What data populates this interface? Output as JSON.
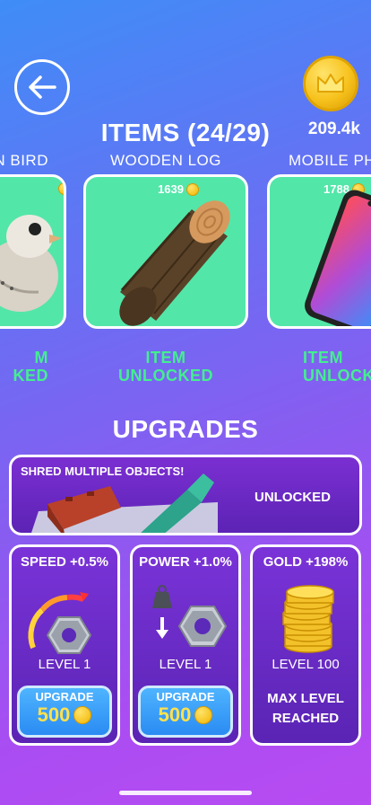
{
  "header": {
    "back_icon": "arrow-left-icon",
    "coin_icon": "crown-coin-icon",
    "coin_balance": "209.4k",
    "title": "ITEMS (24/29)"
  },
  "items": [
    {
      "name": "N BIRD",
      "price": "",
      "status_line1": "M",
      "status_line2": "KED",
      "image": "toy-bird"
    },
    {
      "name": "WOODEN LOG",
      "price": "1639",
      "status_line1": "ITEM",
      "status_line2": "UNLOCKED",
      "image": "wooden-log"
    },
    {
      "name": "MOBILE PH",
      "price": "1788",
      "status_line1": "ITEM",
      "status_line2": "UNLOCKED",
      "image": "mobile-phone"
    }
  ],
  "upgrades": {
    "title": "UPGRADES",
    "multi": {
      "title": "SHRED MULTIPLE OBJECTS!",
      "status": "UNLOCKED"
    },
    "cards": [
      {
        "label": "SPEED +0.5%",
        "level": "LEVEL 1",
        "button_label": "UPGRADE",
        "cost": "500",
        "icon": "speed-gauge-shredder-icon"
      },
      {
        "label": "POWER +1.0%",
        "level": "LEVEL 1",
        "button_label": "UPGRADE",
        "cost": "500",
        "icon": "weight-shredder-icon"
      },
      {
        "label": "GOLD +198%",
        "level": "LEVEL 100",
        "max_line1": "MAX LEVEL",
        "max_line2": "REACHED",
        "icon": "gold-coins-stack-icon"
      }
    ]
  },
  "colors": {
    "item_card_bg": "#53e6a9",
    "unlocked_text": "#43ef8f",
    "upgrade_button": "#2a8bf2",
    "cost_text": "#ffe14d"
  }
}
